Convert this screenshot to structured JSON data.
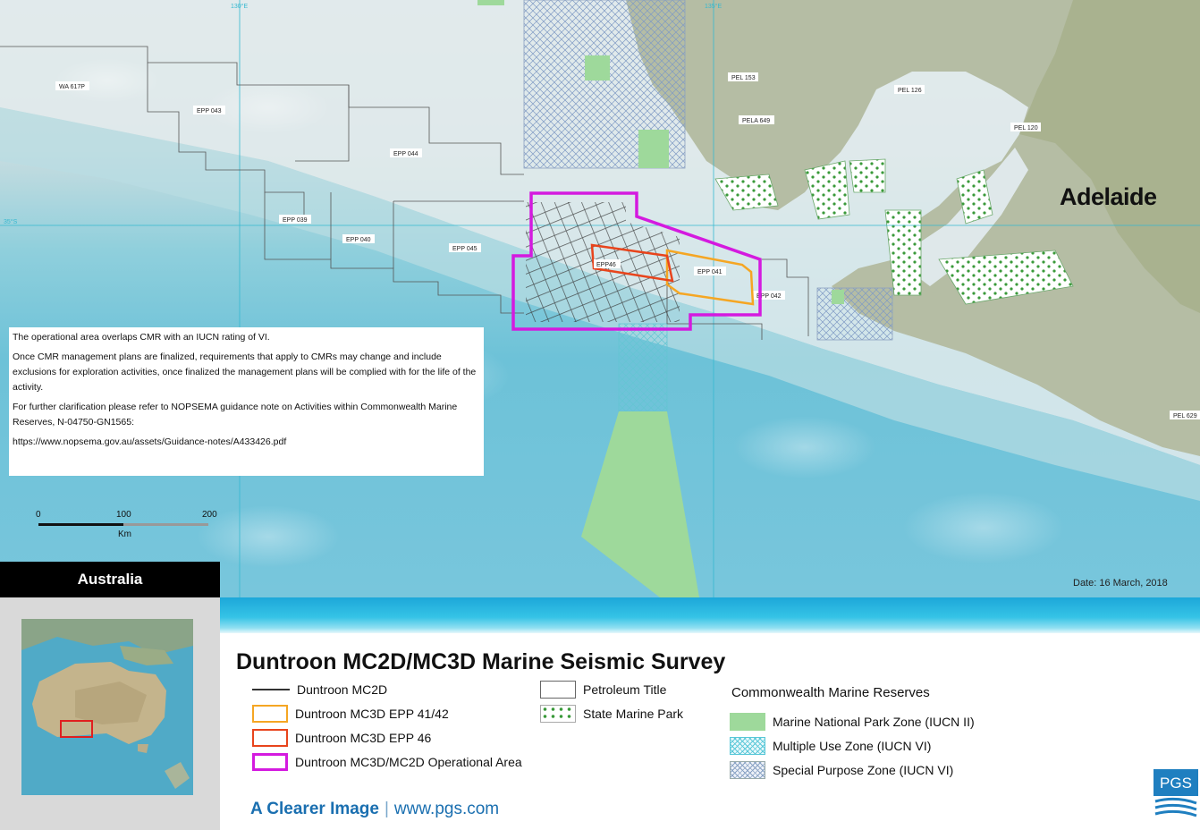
{
  "map": {
    "city_label": "Adelaide",
    "grid_labels": [
      "130°E",
      "135°E",
      "35°S"
    ],
    "block_labels": [
      "WA 617P",
      "EPP 043",
      "EPP 044",
      "EPP 039",
      "EPP 040",
      "EPP 045",
      "EPP46",
      "EPP 041",
      "EPP 042",
      "PEL 153",
      "PELA 649",
      "PEL 126",
      "PEL 120",
      "PEL 629"
    ],
    "info_text": {
      "p1": "The operational area overlaps CMR with an IUCN rating of VI.",
      "p2": "Once CMR management plans are finalized, requirements that apply to CMRs may change and include exclusions for exploration activities, once finalized the management plans will be complied with for the life of the activity.",
      "p3": "For further clarification please refer to NOPSEMA guidance note on Activities within Commonwealth Marine Reserves, N-04750-GN1565:",
      "p4": "https://www.nopsema.gov.au/assets/Guidance-notes/A433426.pdf"
    },
    "scale": {
      "tick0": "0",
      "tick1": "100",
      "tick2": "200",
      "unit": "Km"
    },
    "date": "Date: 16 March, 2018"
  },
  "inset": {
    "title": "Australia"
  },
  "legend": {
    "title": "Duntroon MC2D/MC3D Marine Seismic Survey",
    "items": [
      {
        "label": "Duntroon MC2D",
        "color": "#333333"
      },
      {
        "label": "Duntroon MC3D EPP 41/42",
        "color": "#f5a623"
      },
      {
        "label": "Duntroon MC3D EPP 46",
        "color": "#e8441c"
      },
      {
        "label": "Duntroon MC3D/MC2D Operational Area",
        "color": "#d41adf"
      }
    ],
    "other_items": [
      {
        "label": "Petroleum Title"
      },
      {
        "label": "State Marine Park"
      }
    ],
    "cmr_title": "Commonwealth Marine Reserves",
    "cmr_items": [
      {
        "label": "Marine National Park Zone (IUCN II)"
      },
      {
        "label": "Multiple Use Zone (IUCN VI)"
      },
      {
        "label": "Special Purpose Zone (IUCN VI)"
      }
    ]
  },
  "footer": {
    "tagline_strong": "A Clearer Image",
    "tagline_sep": "|",
    "tagline_url": "www.pgs.com",
    "logo_text": "PGS"
  }
}
